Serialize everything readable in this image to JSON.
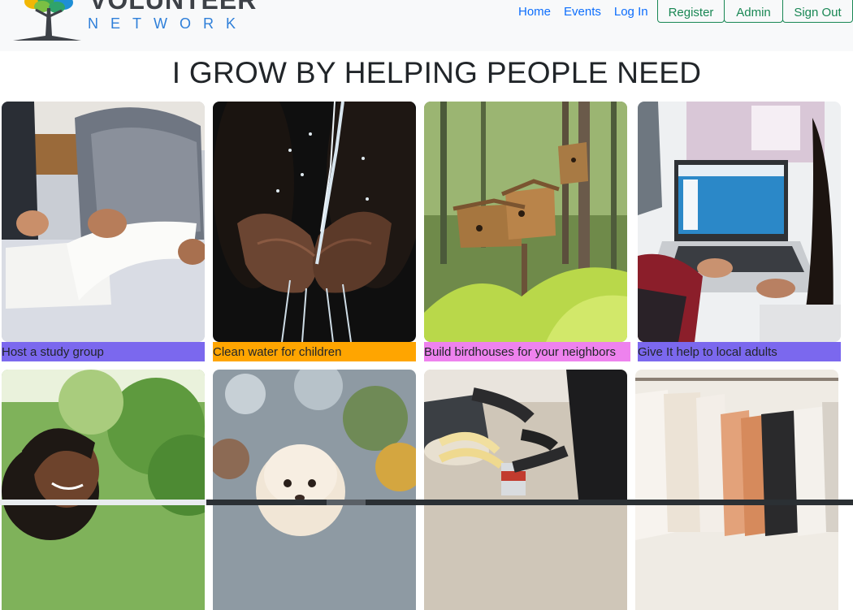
{
  "brand": {
    "word": "VOLUNTEER",
    "sub": "NETWORK"
  },
  "nav": {
    "links": [
      "Home",
      "Events",
      "Log In"
    ],
    "register": "Register",
    "admin": "Admin",
    "signout": "Sign Out"
  },
  "page_title": "I GROW BY HELPING PEOPLE NEED",
  "cards": [
    {
      "caption": "Host a study group",
      "caption_color": "#7b68ee",
      "image": "study-group-photo"
    },
    {
      "caption": "Clean water for children",
      "caption_color": "#ffa500",
      "image": "water-hands-photo"
    },
    {
      "caption": "Build birdhouses for your neighbors",
      "caption_color": "#ee82ee",
      "image": "birdhouses-photo"
    },
    {
      "caption": "Give It help to local adults",
      "caption_color": "#7b68ee",
      "image": "laptop-typing-photo"
    },
    {
      "caption": "",
      "image": "smiling-girl-photo"
    },
    {
      "caption": "",
      "image": "white-dog-photo"
    },
    {
      "caption": "",
      "image": "food-donation-photo"
    },
    {
      "caption": "",
      "image": "clothing-rack-photo"
    }
  ]
}
